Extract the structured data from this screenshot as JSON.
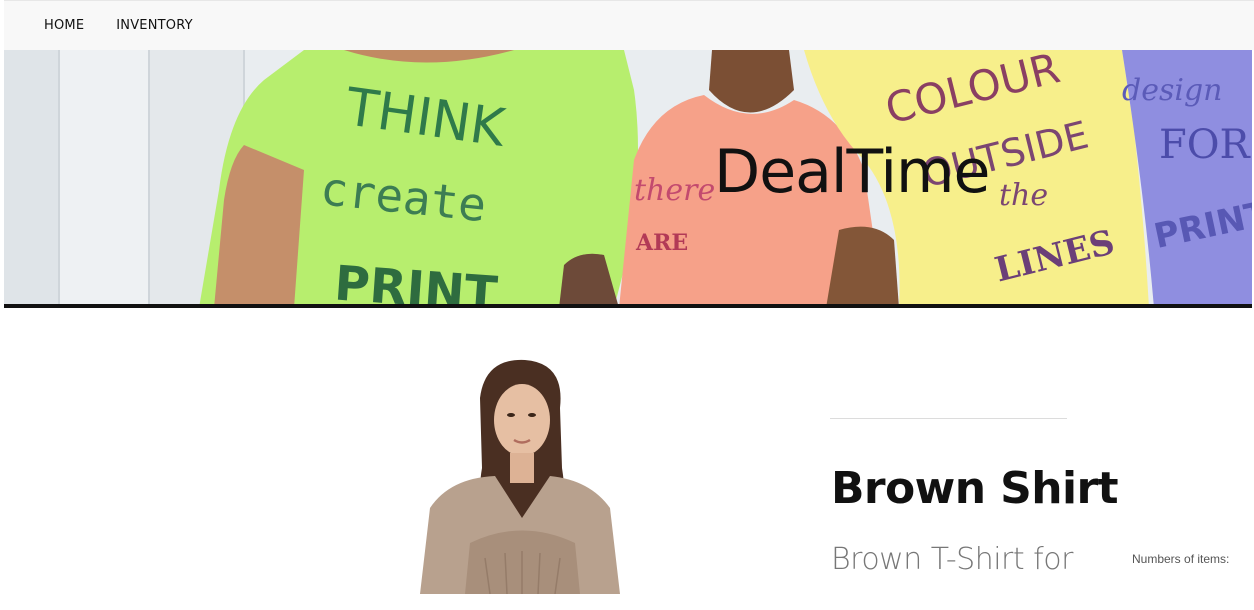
{
  "nav": {
    "items": [
      {
        "label": "HOME"
      },
      {
        "label": "INVENTORY"
      }
    ]
  },
  "hero": {
    "title": "DealTime",
    "shirt_texts": [
      "THINK",
      "create",
      "PRINT",
      "there",
      "ARE",
      "COLOUR",
      "OUTSIDE",
      "the",
      "LINES",
      "design",
      "FOR",
      "PRINT"
    ]
  },
  "product": {
    "name": "Brown Shirt",
    "description": "Brown T-Shirt for",
    "quantity_label": "Numbers of items:"
  }
}
